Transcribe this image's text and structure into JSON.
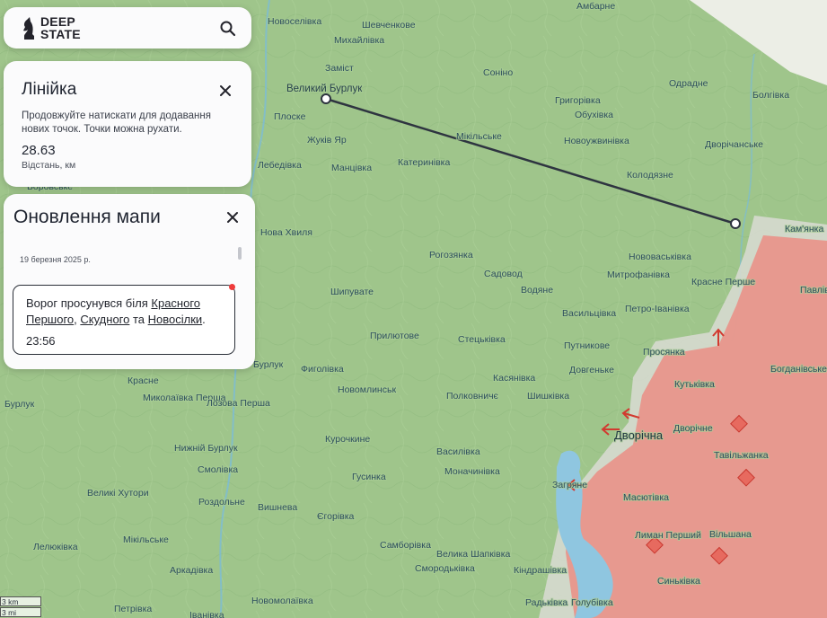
{
  "logo": {
    "line1": "DEEP",
    "line2": "STATE"
  },
  "ruler": {
    "title": "Лінійка",
    "description": "Продовжуйте натискати для додавання нових точок. Точки можна рухати.",
    "distance": "28.63",
    "distance_label": "Відстань, км"
  },
  "updates": {
    "title": "Оновлення мапи",
    "date": "19 березня 2025 р.",
    "item": {
      "prefix": "Ворог просунувся біля ",
      "link1": "Красного Першого",
      "sep1": ", ",
      "link2": "Скудного",
      "sep2": " та ",
      "link3": "Новосілки",
      "suffix": ".",
      "time": "23:56"
    }
  },
  "scale": {
    "metric": "3 km",
    "imperial": "3 mi"
  },
  "colors": {
    "occupied": "#e8948a",
    "terrain": "#9cc38a",
    "ruler_line": "#2e3440"
  },
  "places": [
    "Амбарне",
    "Новоселівка",
    "Шевченкове",
    "Михайлівка",
    "Заміст",
    "Соніно",
    "Одрадне",
    "Великий Бурлук",
    "Григорівка",
    "Болгівка",
    "Плоске",
    "Обухівка",
    "Жуків Яр",
    "Мікільське",
    "Новоужвинівка",
    "Манцівка",
    "Катеринівка",
    "Дворічанське",
    "Лебедівка",
    "Колодязне",
    "Кам'янка",
    "Боровське",
    "Рогозянка",
    "Нова Хвиля",
    "Нововаськівка",
    "Садовод",
    "Водяне",
    "Митрофанівка",
    "Шипувате",
    "Красне Перше",
    "Павлівка",
    "Васильцівка",
    "Петро-Іванівка",
    "Прилютове",
    "Стецьківка",
    "Путникове",
    "Бурлук",
    "Фиголівка",
    "Просянка",
    "Касянівка",
    "Довгеньке",
    "Богданівське",
    "Красне",
    "Миколаївка Перша",
    "Лозова Перша",
    "Кутьківка",
    "Новомлинськ",
    "Полковничє",
    "Шишківка",
    "Дворічне",
    "Дворічна",
    "Курочкине",
    "Тавільжанка",
    "Нижній Бурлук",
    "Василівка",
    "Смолівка",
    "Моначинівка",
    "Загряне",
    "Великі Хутори",
    "Гусинка",
    "Масютівка",
    "Роздольне",
    "Вишнева",
    "Єгорівка",
    "Лелюківка",
    "Мікільське",
    "Самборівка",
    "Велика Шапківка",
    "Лиман Перший",
    "Вільшана",
    "Аркадівка",
    "Смородьківка",
    "Кіндрашівка",
    "Новомолаївка",
    "Радьківка",
    "Голубівка",
    "Синьківка",
    "Петрівка",
    "Іванівка",
    "Бурлук"
  ]
}
